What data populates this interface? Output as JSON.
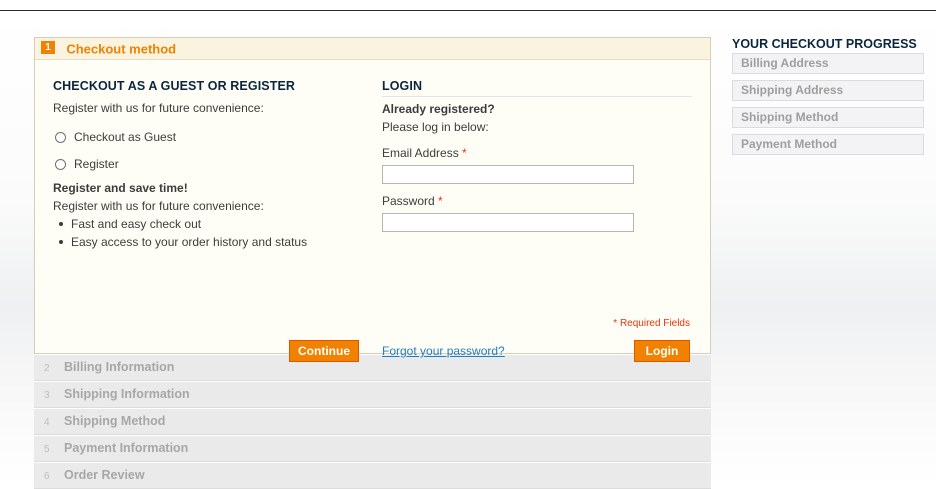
{
  "checkout": {
    "active_step": {
      "number": "1",
      "title": "Checkout method"
    },
    "guest_column": {
      "title": "CHECKOUT AS A GUEST OR REGISTER",
      "intro": "Register with us for future convenience:",
      "options": [
        "Checkout as Guest",
        "Register"
      ],
      "save_time_heading": "Register and save time!",
      "save_time_text": "Register with us for future convenience:",
      "benefits": [
        "Fast and easy check out",
        "Easy access to your order history and status"
      ],
      "continue_label": "Continue"
    },
    "login_column": {
      "title": "LOGIN",
      "already_registered": "Already registered?",
      "please_login": "Please log in below:",
      "email_label": "Email Address",
      "password_label": "Password",
      "required_marker": "*",
      "required_note": "* Required Fields",
      "forgot_link": "Forgot your password?",
      "login_label": "Login"
    },
    "other_steps": [
      {
        "number": "2",
        "title": "Billing Information"
      },
      {
        "number": "3",
        "title": "Shipping Information"
      },
      {
        "number": "4",
        "title": "Shipping Method"
      },
      {
        "number": "5",
        "title": "Payment Information"
      },
      {
        "number": "6",
        "title": "Order Review"
      }
    ]
  },
  "progress": {
    "title": "YOUR CHECKOUT PROGRESS",
    "items": [
      "Billing Address",
      "Shipping Address",
      "Shipping Method",
      "Payment Method"
    ]
  },
  "colors": {
    "accent": "#f18200",
    "link": "#1e7ec8",
    "required": "#eb340a"
  }
}
